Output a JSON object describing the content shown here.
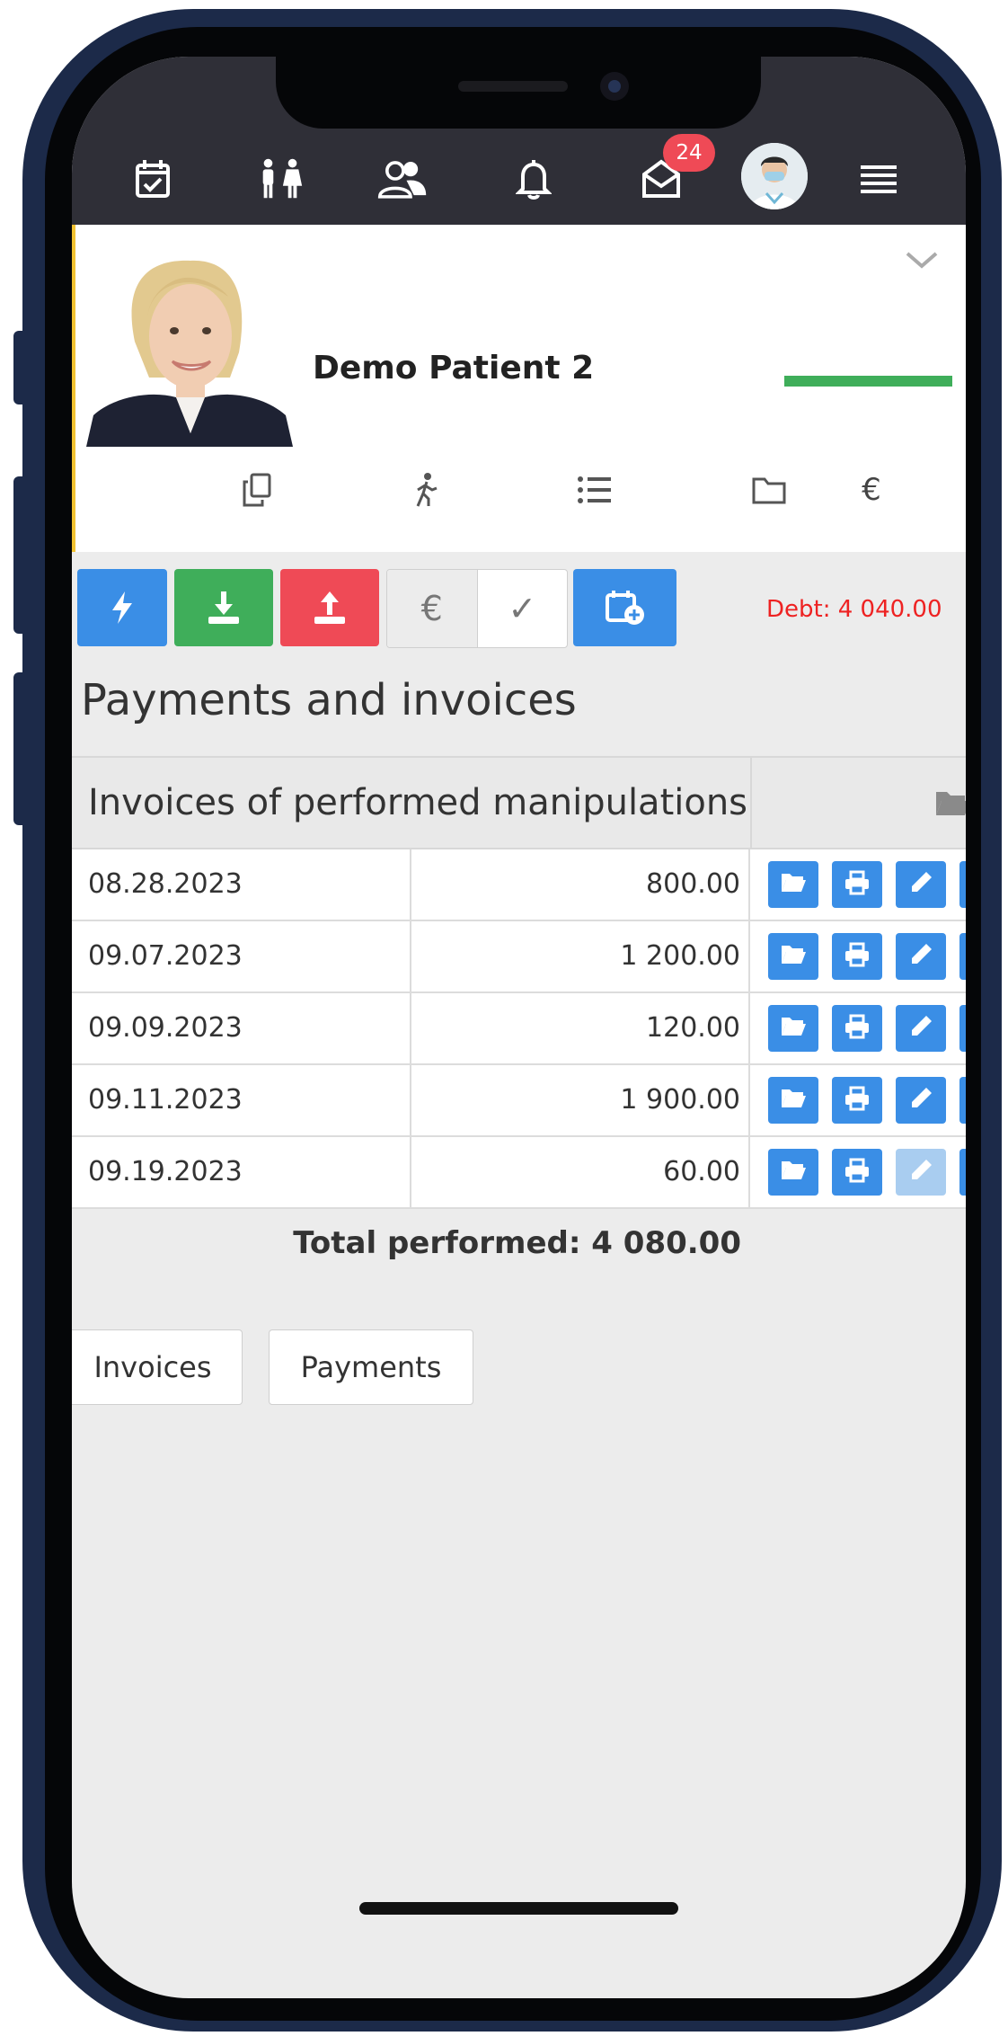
{
  "navbar": {
    "icons": [
      "calendar-check-icon",
      "patients-icon",
      "users-icon",
      "bell-icon",
      "envelope-open-icon",
      "menu-icon"
    ],
    "messages_badge": "24",
    "accent": "#2f2f37"
  },
  "patient": {
    "name": "Demo Patient 2",
    "tabs": [
      {
        "icon": "copy-icon",
        "glyph": "⧉"
      },
      {
        "icon": "walking-icon",
        "glyph": "🚶"
      },
      {
        "icon": "list-icon",
        "glyph": "☰"
      },
      {
        "icon": "folder-icon",
        "glyph": "🗀"
      },
      {
        "icon": "euro-icon",
        "glyph": "€",
        "active": true
      }
    ],
    "active_tab_color": "#3fae5a"
  },
  "toolbar": {
    "euro_label": "€",
    "check_label": "✓",
    "debt": "Debt: 4 040.00",
    "colors": {
      "blue": "#3a8ee6",
      "green": "#3fae5a",
      "red": "#ef4a56",
      "debt": "#ee2222"
    }
  },
  "page": {
    "title": "Payments and invoices"
  },
  "table": {
    "header": "Invoices of performed manipulations",
    "rows": [
      {
        "date": "08.28.2023",
        "amount": "800.00",
        "edit_enabled": true
      },
      {
        "date": "09.07.2023",
        "amount": "1 200.00",
        "edit_enabled": true
      },
      {
        "date": "09.09.2023",
        "amount": "120.00",
        "edit_enabled": true
      },
      {
        "date": "09.11.2023",
        "amount": "1 900.00",
        "edit_enabled": true
      },
      {
        "date": "09.19.2023",
        "amount": "60.00",
        "edit_enabled": false
      }
    ],
    "total": "Total performed: 4 080.00"
  },
  "footer_buttons": {
    "invoices": "Invoices",
    "payments": "Payments"
  }
}
